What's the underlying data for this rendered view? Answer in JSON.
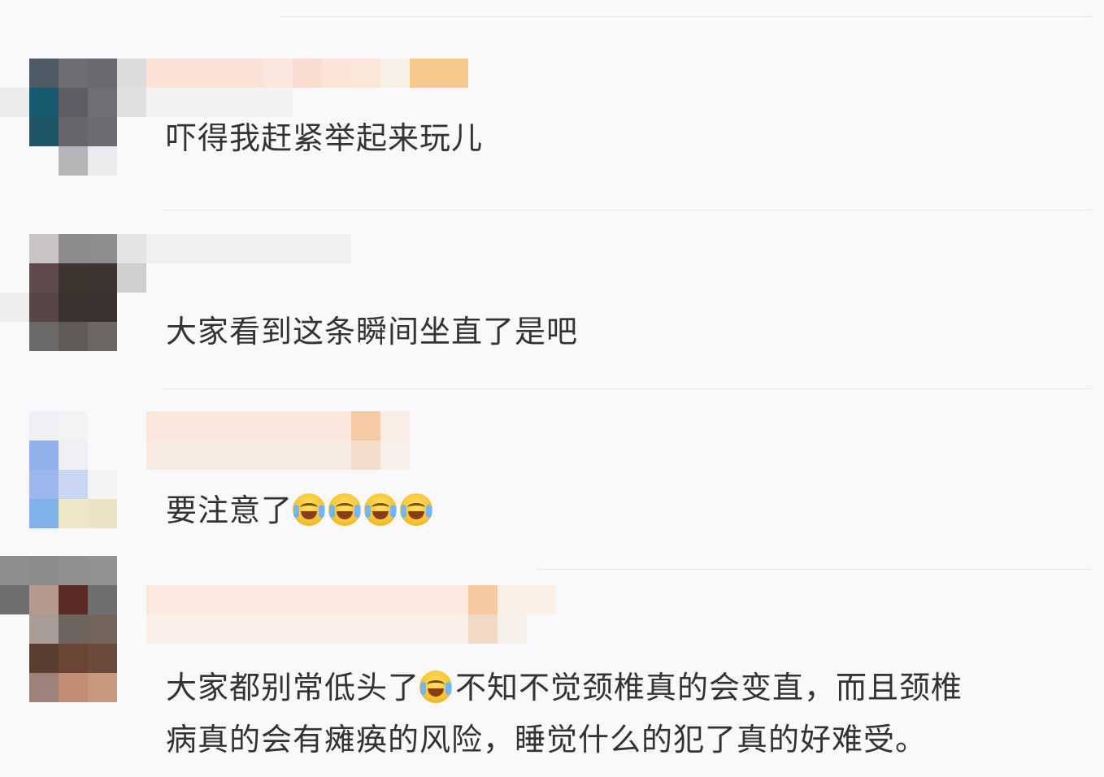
{
  "comments": [
    {
      "text": "吓得我赶紧举起来玩儿"
    },
    {
      "text": "大家看到这条瞬间坐直了是吧"
    },
    {
      "text_before_emoji": "要注意了",
      "emoji_count": 4,
      "emoji_icon": "laugh-cry-emoji-icon"
    },
    {
      "line1_part1": "大家都别常低头了",
      "line1_part2": "不知不觉颈椎真的会变直，而且颈椎",
      "line2": "病真的会有瘫痪的风险，睡觉什么的犯了真的好难受。",
      "emoji_icon": "laugh-cry-emoji-icon"
    }
  ],
  "colors": {
    "background": "#f9f9fb",
    "text": "#333333",
    "separator": "#e6e6ea"
  }
}
